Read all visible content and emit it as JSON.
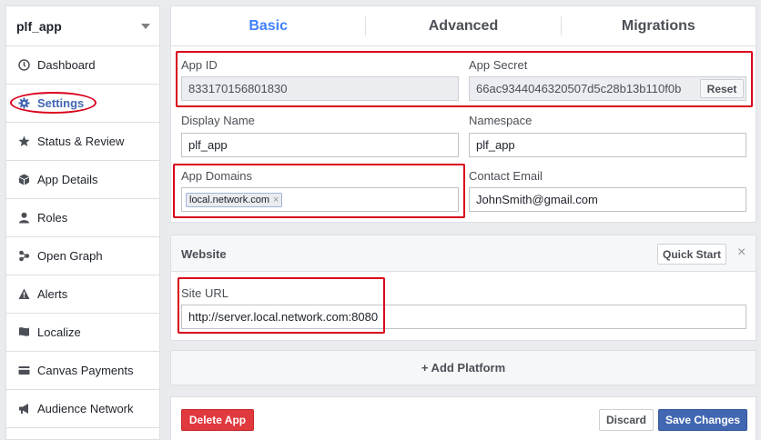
{
  "sidebar": {
    "app_name": "plf_app",
    "items": [
      {
        "label": "Dashboard"
      },
      {
        "label": "Settings"
      },
      {
        "label": "Status & Review"
      },
      {
        "label": "App Details"
      },
      {
        "label": "Roles"
      },
      {
        "label": "Open Graph"
      },
      {
        "label": "Alerts"
      },
      {
        "label": "Localize"
      },
      {
        "label": "Canvas Payments"
      },
      {
        "label": "Audience Network"
      }
    ]
  },
  "tabs": [
    "Basic",
    "Advanced",
    "Migrations"
  ],
  "basic": {
    "app_id_label": "App ID",
    "app_id": "833170156801830",
    "app_secret_label": "App Secret",
    "app_secret": "66ac9344046320507d5c28b13b110f0b",
    "reset_label": "Reset",
    "display_name_label": "Display Name",
    "display_name": "plf_app",
    "namespace_label": "Namespace",
    "namespace": "plf_app",
    "app_domains_label": "App Domains",
    "app_domain_tag": "local.network.com",
    "tag_remove": "×",
    "contact_email_label": "Contact Email",
    "contact_email": "JohnSmith@gmail.com"
  },
  "website": {
    "title": "Website",
    "quick_start_label": "Quick Start",
    "close": "×",
    "site_url_label": "Site URL",
    "site_url": "http://server.local.network.com:8080"
  },
  "add_platform_label": "+ Add Platform",
  "footer": {
    "delete_label": "Delete App",
    "discard_label": "Discard",
    "save_label": "Save Changes"
  },
  "colors": {
    "accent": "#4080ff",
    "brand_blue": "#4267b2",
    "annotation_red": "#d9001b",
    "delete_red": "#e0393e"
  }
}
